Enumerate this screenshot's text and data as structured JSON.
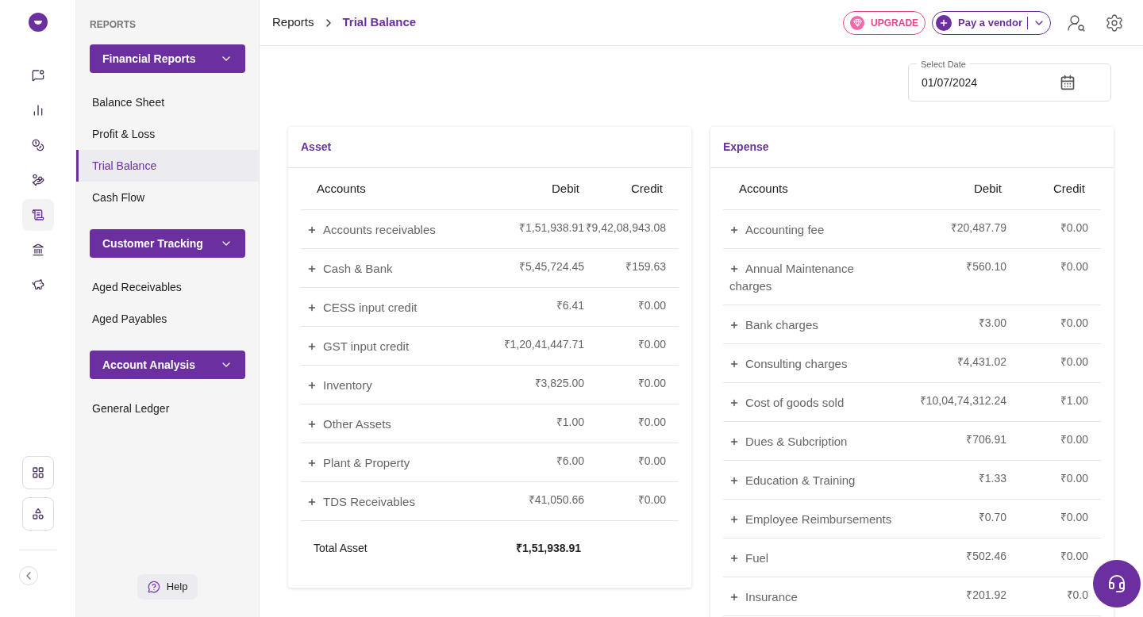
{
  "rail": {
    "items": [
      {
        "selected": false
      },
      {
        "selected": false
      },
      {
        "selected": false
      },
      {
        "selected": false
      },
      {
        "selected": true
      },
      {
        "selected": false
      },
      {
        "selected": false
      }
    ]
  },
  "sidebar": {
    "heading": "REPORTS",
    "groups": [
      {
        "title": "Financial Reports",
        "items": [
          {
            "label": "Balance Sheet",
            "selected": false
          },
          {
            "label": "Profit & Loss",
            "selected": false
          },
          {
            "label": "Trial Balance",
            "selected": true
          },
          {
            "label": "Cash Flow",
            "selected": false
          }
        ]
      },
      {
        "title": "Customer Tracking",
        "items": [
          {
            "label": "Aged Receivables",
            "selected": false
          },
          {
            "label": "Aged Payables",
            "selected": false
          }
        ]
      },
      {
        "title": "Account Analysis",
        "items": [
          {
            "label": "General Ledger",
            "selected": false
          }
        ]
      }
    ],
    "help": "Help"
  },
  "breadcrumb": [
    "Reports",
    "Trial Balance"
  ],
  "header": {
    "upgrade": "UPGRADE",
    "pay": "Pay a vendor"
  },
  "date": {
    "label": "Select Date",
    "value": "01/07/2024"
  },
  "cards": [
    {
      "title": "Asset",
      "columns": [
        "Accounts",
        "Debit",
        "Credit"
      ],
      "rows": [
        {
          "name": "Accounts receivables",
          "debit": "₹1,51,938.91",
          "credit": "₹9,42,08,943.08"
        },
        {
          "name": "Cash & Bank",
          "debit": "₹5,45,724.45",
          "credit": "₹159.63"
        },
        {
          "name": "CESS input credit",
          "debit": "₹6.41",
          "credit": "₹0.00"
        },
        {
          "name": "GST input credit",
          "debit": "₹1,20,41,447.71",
          "credit": "₹0.00"
        },
        {
          "name": "Inventory",
          "debit": "₹3,825.00",
          "credit": "₹0.00"
        },
        {
          "name": "Other Assets",
          "debit": "₹1.00",
          "credit": "₹0.00"
        },
        {
          "name": "Plant & Property",
          "debit": "₹6.00",
          "credit": "₹0.00"
        },
        {
          "name": "TDS Receivables",
          "debit": "₹41,050.66",
          "credit": "₹0.00"
        }
      ],
      "total": {
        "label": "Total Asset",
        "debit": "₹1,51,938.91"
      }
    },
    {
      "title": "Expense",
      "columns": [
        "Accounts",
        "Debit",
        "Credit"
      ],
      "rows": [
        {
          "name": "Accounting fee",
          "debit": "₹20,487.79",
          "credit": "₹0.00"
        },
        {
          "name": "Annual Maintenance charges",
          "debit": "₹560.10",
          "credit": "₹0.00"
        },
        {
          "name": "Bank charges",
          "debit": "₹3.00",
          "credit": "₹0.00"
        },
        {
          "name": "Consulting charges",
          "debit": "₹4,431.02",
          "credit": "₹0.00"
        },
        {
          "name": "Cost of goods sold",
          "debit": "₹10,04,74,312.24",
          "credit": "₹1.00"
        },
        {
          "name": "Dues & Subcription",
          "debit": "₹706.91",
          "credit": "₹0.00"
        },
        {
          "name": "Education & Training",
          "debit": "₹1.33",
          "credit": "₹0.00"
        },
        {
          "name": "Employee Reimbursements",
          "debit": "₹0.70",
          "credit": "₹0.00"
        },
        {
          "name": "Fuel",
          "debit": "₹502.46",
          "credit": "₹0.00"
        },
        {
          "name": "Insurance",
          "debit": "₹201.92",
          "credit": "₹0.0"
        }
      ]
    }
  ]
}
